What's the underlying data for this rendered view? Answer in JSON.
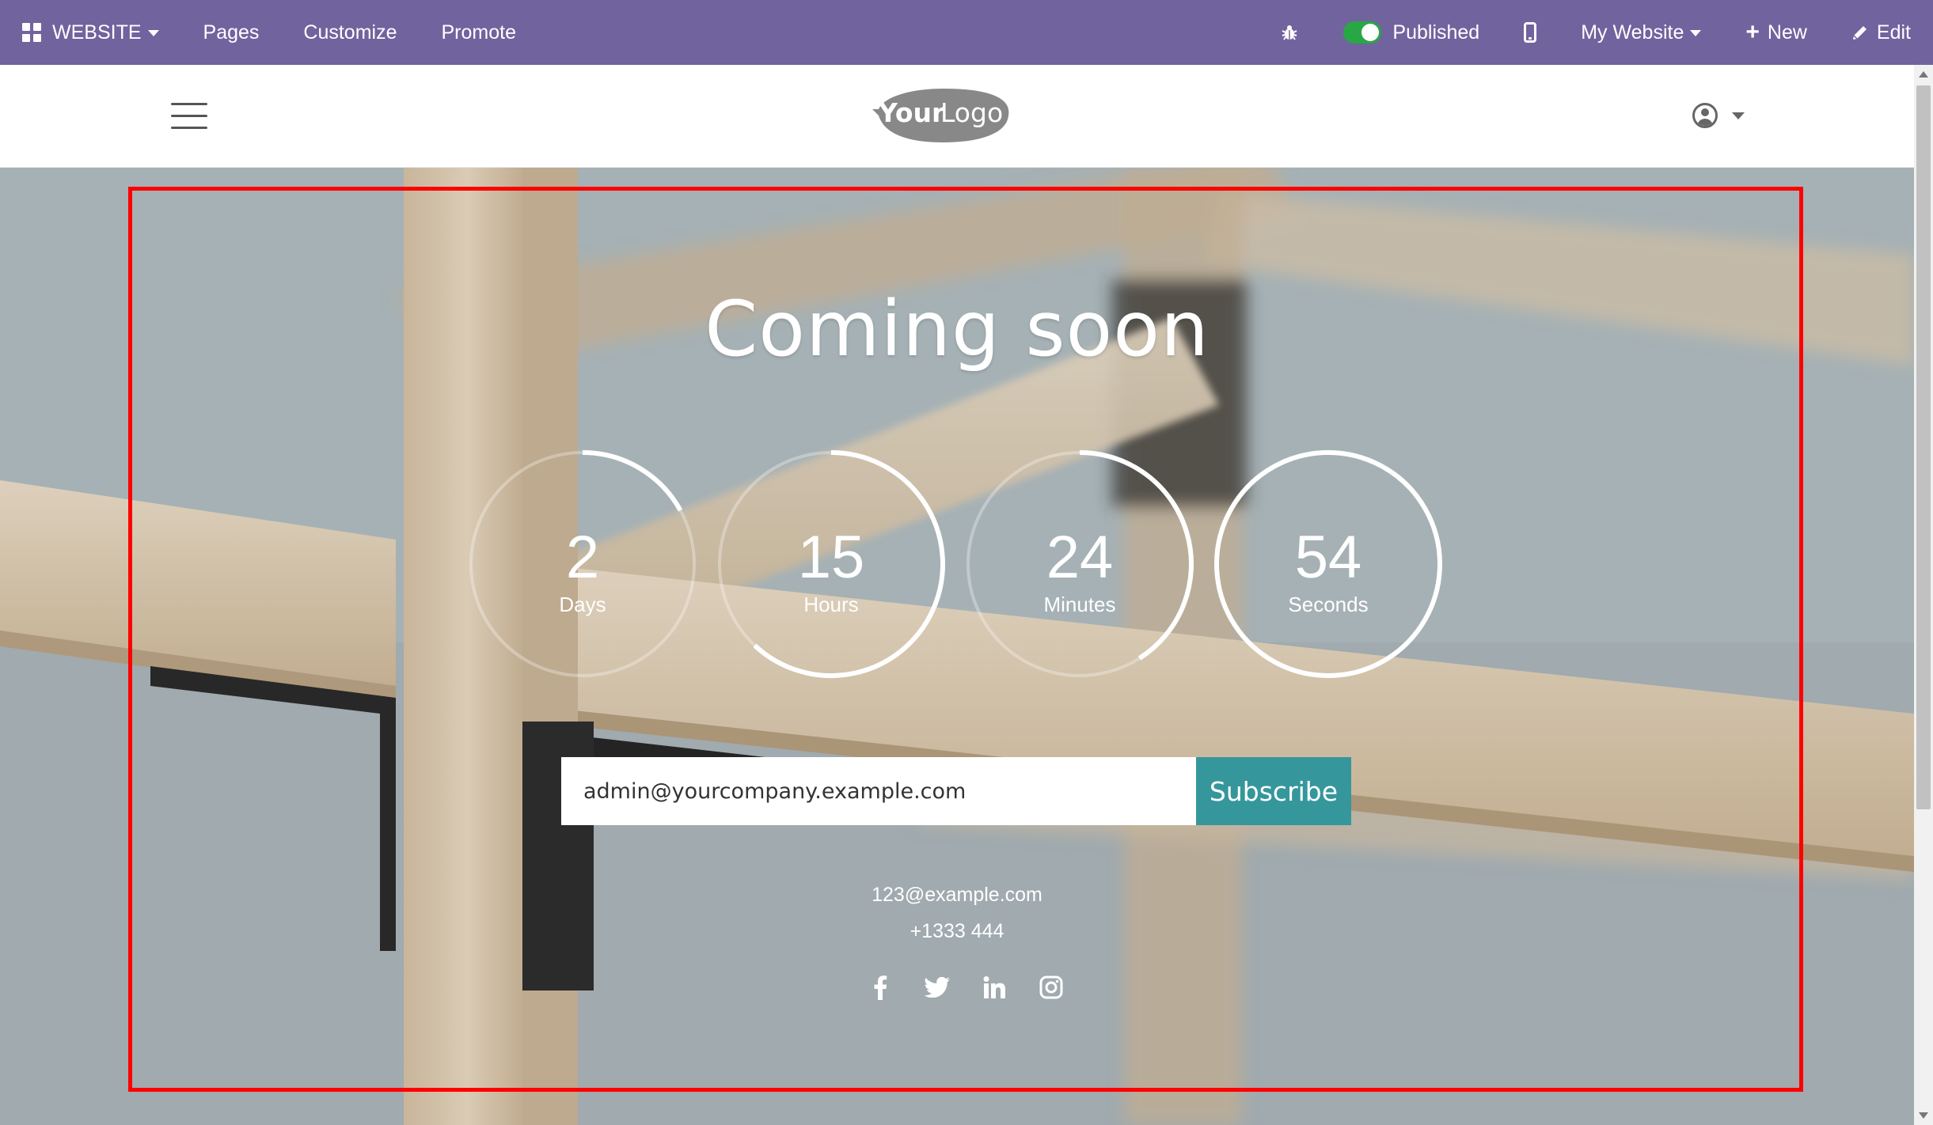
{
  "topbar": {
    "app_label": "WEBSITE",
    "pages_label": "Pages",
    "customize_label": "Customize",
    "promote_label": "Promote",
    "published_label": "Published",
    "website_label": "My Website",
    "new_label": "New",
    "edit_label": "Edit",
    "bg_color": "#71639e"
  },
  "header": {
    "logo_text_bold": "Your",
    "logo_text_light": "Logo"
  },
  "hero": {
    "title": "Coming soon",
    "countdown": [
      {
        "value": "2",
        "label": "Days",
        "progress": 0.17
      },
      {
        "value": "15",
        "label": "Hours",
        "progress": 0.62
      },
      {
        "value": "24",
        "label": "Minutes",
        "progress": 0.41
      },
      {
        "value": "54",
        "label": "Seconds",
        "progress": 1.0
      }
    ],
    "email_value": "admin@yourcompany.example.com",
    "subscribe_label": "Subscribe",
    "contact_email": "123@example.com",
    "contact_phone": "+1333 444",
    "social_icons": [
      "facebook-icon",
      "twitter-icon",
      "linkedin-icon",
      "instagram-icon"
    ],
    "accent_color": "#35979c"
  }
}
